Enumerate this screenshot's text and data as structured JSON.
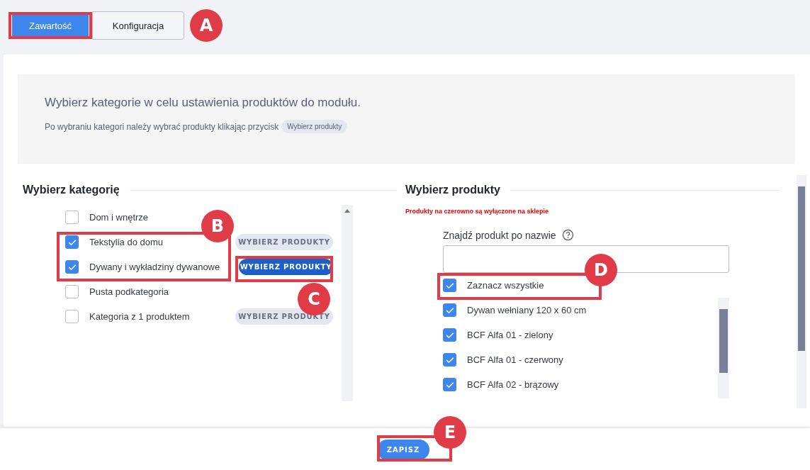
{
  "tabs": [
    {
      "label": "Zawartość",
      "selected": true
    },
    {
      "label": "Konfiguracja",
      "selected": false
    }
  ],
  "info": {
    "title": "Wybierz kategorie w celu ustawienia produktów do modułu.",
    "text": "Po wybraniu kategori należy wybrać produkty klikając przycisk",
    "chip": "Wybierz produkty"
  },
  "categories": {
    "heading": "Wybierz kategorię",
    "items": [
      {
        "label": "Dom i wnętrze",
        "checked": false
      },
      {
        "label": "Tekstylia do domu",
        "checked": true,
        "button": {
          "label": "WYBIERZ PRODUKTY",
          "active": false
        }
      },
      {
        "label": "Dywany i wykładziny dywanowe",
        "checked": true,
        "button": {
          "label": "WYBIERZ PRODUKTY",
          "active": true
        }
      },
      {
        "label": "Pusta podkategoria",
        "checked": false
      },
      {
        "label": "Kategoria z 1 produktem",
        "checked": false,
        "button": {
          "label": "WYBIERZ PRODUKTY",
          "active": false
        }
      }
    ]
  },
  "products": {
    "heading": "Wybierz produkty",
    "warning": "Produkty na czerowno są wyłączone na sklepie",
    "search_label": "Znajdź produkt po nazwie",
    "select_all": {
      "label": "Zaznacz wszystkie",
      "checked": true
    },
    "items": [
      {
        "label": "Dywan wełniany 120 x 60 cm",
        "checked": true
      },
      {
        "label": "BCF Alfa 01 - zielony",
        "checked": true
      },
      {
        "label": "BCF Alfa 01 - czerwony",
        "checked": true
      },
      {
        "label": "BCF Alfa 02 - brązowy",
        "checked": true
      }
    ]
  },
  "save_button": "ZAPISZ",
  "annotations": [
    {
      "letter": "A"
    },
    {
      "letter": "B"
    },
    {
      "letter": "C"
    },
    {
      "letter": "D"
    },
    {
      "letter": "E"
    }
  ]
}
